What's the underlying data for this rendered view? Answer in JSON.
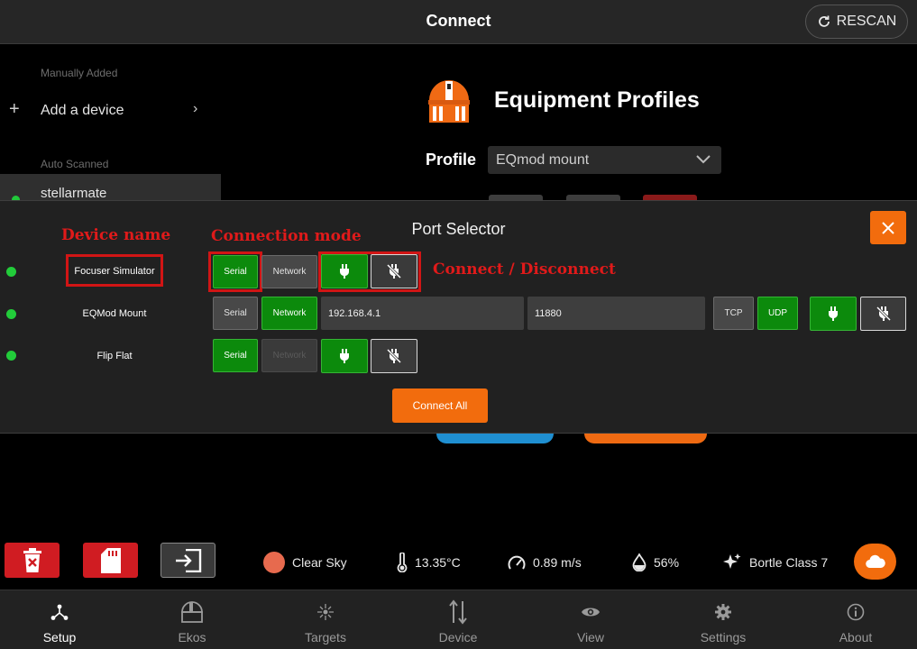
{
  "header": {
    "title": "Connect",
    "rescan_label": "RESCAN"
  },
  "sidebar": {
    "manual_heading": "Manually Added",
    "add_device_label": "Add a device",
    "auto_heading": "Auto Scanned",
    "scanned_device": "stellarmate"
  },
  "profiles": {
    "title": "Equipment Profiles",
    "profile_label": "Profile",
    "selected_profile": "EQmod mount"
  },
  "port_selector": {
    "title": "Port Selector",
    "annotations": {
      "device_name": "Device name",
      "connection_mode": "Connection mode",
      "connect_disconnect": "Connect / Disconnect"
    },
    "serial_label": "Serial",
    "network_label": "Network",
    "tcp_label": "TCP",
    "udp_label": "UDP",
    "devices": [
      {
        "name": "Focuser Simulator",
        "mode": "Serial",
        "status_color": "#22cc3a"
      },
      {
        "name": "EQMod Mount",
        "mode": "Network",
        "address": "192.168.4.1",
        "port": "11880",
        "protocol": "UDP",
        "status_color": "#22cc3a"
      },
      {
        "name": "Flip Flat",
        "mode": "Serial",
        "status_color": "#22cc3a"
      }
    ],
    "connect_all_label": "Connect All"
  },
  "actions": {
    "icons": [
      "trash-icon",
      "sd-card-icon",
      "exit-icon"
    ],
    "colors": {
      "danger": "#d01c22",
      "neutral": "#3a3a3a"
    }
  },
  "weather": {
    "sky": "Clear Sky",
    "temperature": "13.35°C",
    "wind": "0.89 m/s",
    "humidity": "56%",
    "bortle": "Bortle Class 7"
  },
  "nav": {
    "items": [
      {
        "label": "Setup",
        "icon": "setup-icon",
        "active": true
      },
      {
        "label": "Ekos",
        "icon": "observatory-icon",
        "active": false
      },
      {
        "label": "Targets",
        "icon": "targets-icon",
        "active": false
      },
      {
        "label": "Device",
        "icon": "device-arrows-icon",
        "active": false
      },
      {
        "label": "View",
        "icon": "eye-icon",
        "active": false
      },
      {
        "label": "Settings",
        "icon": "gear-icon",
        "active": false
      },
      {
        "label": "About",
        "icon": "info-icon",
        "active": false
      }
    ]
  },
  "colors": {
    "accent": "#f26c0d",
    "connected": "#0c8a0c",
    "status_ok": "#22cc3a"
  }
}
